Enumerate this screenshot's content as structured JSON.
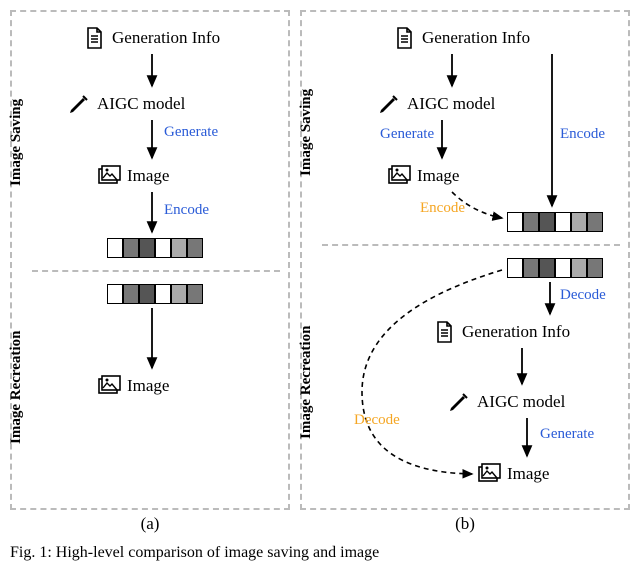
{
  "panels": {
    "a": {
      "caption": "(a)",
      "section_top": "Image Saving",
      "section_bottom": "Image Recreation",
      "nodes": {
        "gen_info": "Generation Info",
        "aigc": "AIGC model",
        "image_top": "Image",
        "image_bottom": "Image"
      },
      "edges": {
        "generate": "Generate",
        "encode": "Encode"
      }
    },
    "b": {
      "caption": "(b)",
      "section_top": "Image Saving",
      "section_bottom": "Image Recreation",
      "nodes": {
        "gen_info_top": "Generation Info",
        "aigc_top": "AIGC model",
        "image_top": "Image",
        "gen_info_bot": "Generation Info",
        "aigc_bot": "AIGC model",
        "image_bot": "Image"
      },
      "edges": {
        "generate_top": "Generate",
        "encode_solid": "Encode",
        "encode_dashed": "Encode",
        "decode_top": "Decode",
        "generate_bot": "Generate",
        "decode_dashed": "Decode"
      }
    }
  },
  "figure_caption_fragment": "Fig. 1: High-level comparison of image saving and image"
}
